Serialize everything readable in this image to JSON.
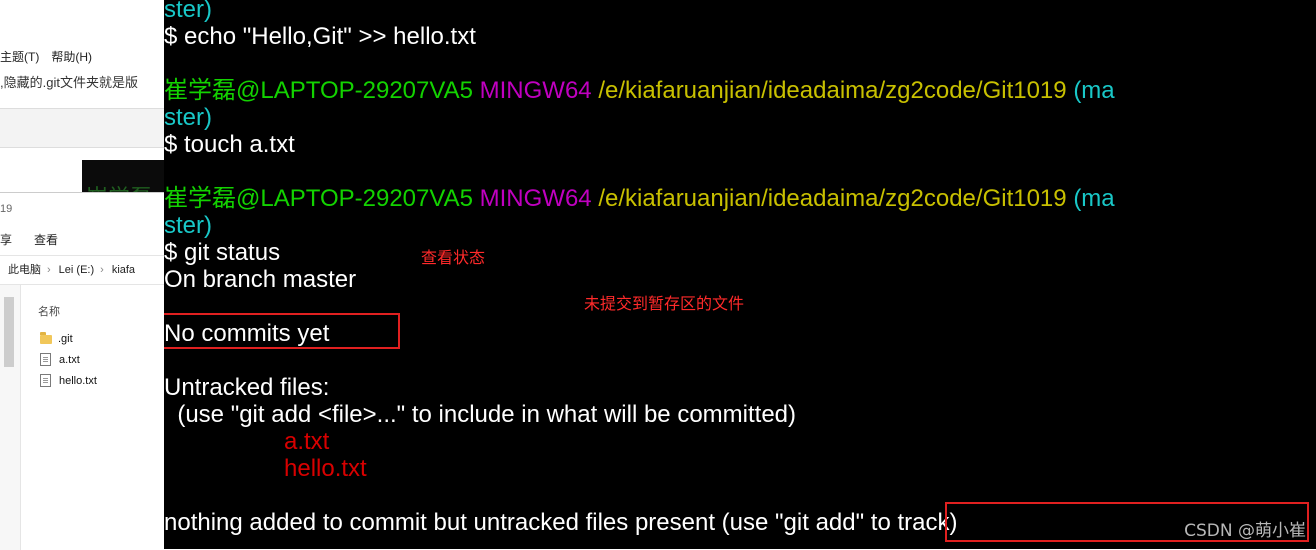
{
  "explorer_back": {
    "menu": [
      "主题(T)",
      "帮助(H)"
    ],
    "info_text": ",隐藏的.git文件夹就是版"
  },
  "explorer_front": {
    "title": "19",
    "ribbon": [
      "享",
      "查看"
    ],
    "address": [
      "此电脑",
      "Lei (E:)",
      "kiafa"
    ],
    "column_header": "名称",
    "files": [
      {
        "name": ".git",
        "icon": "folder-icon"
      },
      {
        "name": "a.txt",
        "icon": "text-file-icon"
      },
      {
        "name": "hello.txt",
        "icon": "text-file-icon"
      }
    ]
  },
  "terminal": {
    "colors": {
      "user": "#13d200",
      "env": "#c000c0",
      "path": "#c8c000",
      "branch": "#19c8c8",
      "untracked": "#d80000"
    },
    "ghost_text": "崔学磊",
    "line_ster_1": "ster)",
    "cmd_echo": "$ echo \"Hello,Git\" >> hello.txt",
    "prompt": {
      "user": "崔学磊@LAPTOP-29207VA5",
      "env": "MINGW64",
      "path": "/e/kiafaruanjian/ideadaima/zg2code/Git1019",
      "branch_open": "(ma",
      "branch_close": "ster)"
    },
    "cmd_touch": "$ touch a.txt",
    "cmd_status": "$ git status",
    "on_branch": "On branch master",
    "no_commits": "No commits yet",
    "untracked_header": "Untracked files:",
    "untracked_hint": "  (use \"git add <file>...\" to include in what will be committed)",
    "untracked_files": [
      "a.txt",
      "hello.txt"
    ],
    "nothing_added": "nothing added to commit but untracked files present ",
    "nothing_hint": "(use \"git add\" to track)"
  },
  "annotations": {
    "view_status": "查看状态",
    "uncommitted_files": "未提交到暂存区的文件"
  },
  "watermark": "CSDN @萌小崔"
}
